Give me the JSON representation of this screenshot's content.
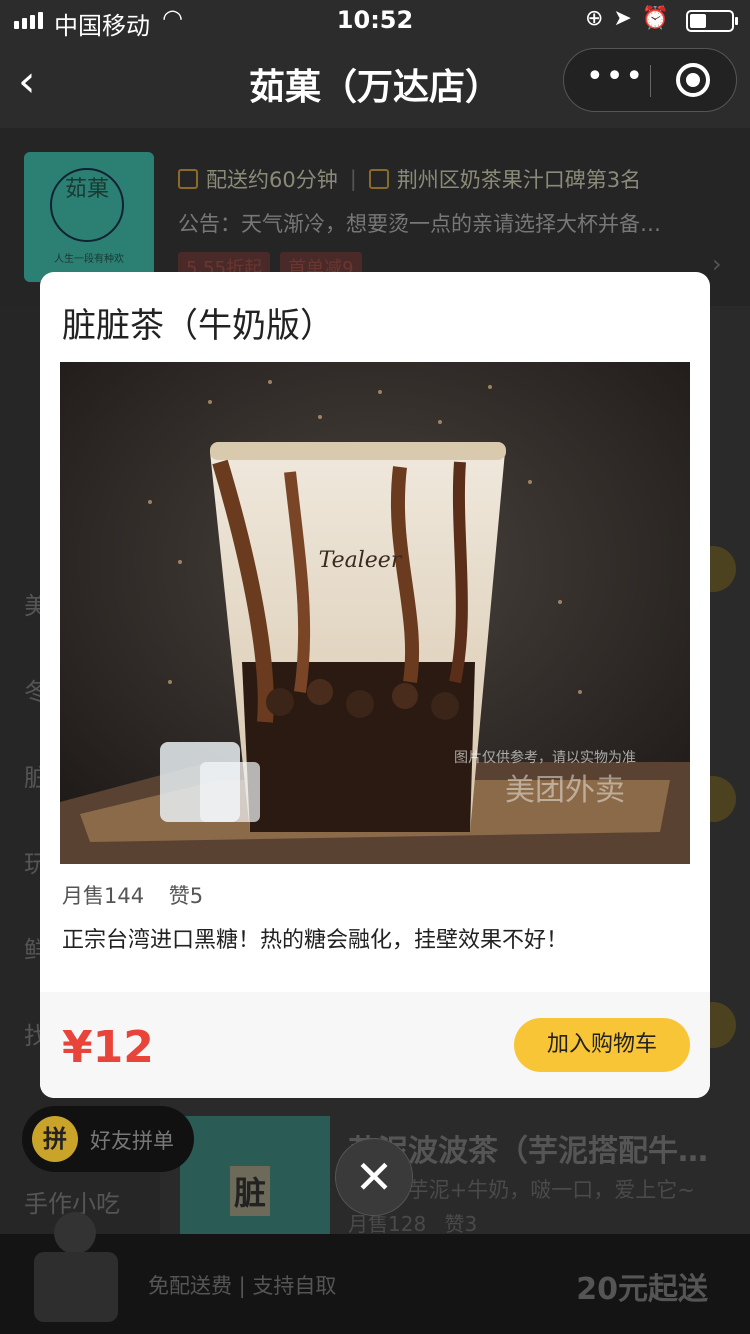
{
  "status_bar": {
    "carrier": "中国移动",
    "time": "10:52",
    "icons": [
      "lock-rotation-icon",
      "location-icon",
      "alarm-icon",
      "battery-icon",
      "wifi-icon",
      "signal-icon"
    ]
  },
  "nav": {
    "back_icon": "‹",
    "title": "茹菓（万达店）",
    "more_icon": "•••"
  },
  "shop": {
    "logo_text": "茹菓",
    "logo_slogan": "人生一段有种欢",
    "delivery_time": "配送约60分钟",
    "ranking": "荆州区奶茶果汁口碑第3名",
    "notice": "公告：天气渐冷，想要烫一点的亲请选择大杯并备…",
    "tags": [
      "5.55折起",
      "首单减9"
    ]
  },
  "sidebar": {
    "items": [
      "美",
      "冬",
      "脏",
      "玩",
      "鲜",
      "找"
    ],
    "snack": "手作小吃"
  },
  "behind_product": {
    "thumb_label": "脏",
    "name": "芋泥波波茶（芋泥搭配牛…",
    "desc": "珍珠+芋泥+牛奶，啵一口，爱上它~",
    "sales": "月售128",
    "likes": "赞3"
  },
  "group_order": {
    "badge": "拼",
    "label": "好友拼单"
  },
  "cart": {
    "info": "免配送费 | 支持自取",
    "min_order": "20元起送"
  },
  "modal": {
    "name": "脏脏茶（牛奶版）",
    "image_brand": "Tealeer",
    "watermark_note": "图片仅供参考，请以实物为准",
    "watermark_logo": "美团外卖",
    "sales": "月售144",
    "likes": "赞5",
    "description": "正宗台湾进口黑糖！热的糖会融化，挂壁效果不好！",
    "price": "¥12",
    "add_to_cart": "加入购物车",
    "close_icon": "✕"
  },
  "colors": {
    "price_red": "#e8443a",
    "button_yellow": "#f8c537",
    "nav_dark": "#2c2c2c"
  }
}
